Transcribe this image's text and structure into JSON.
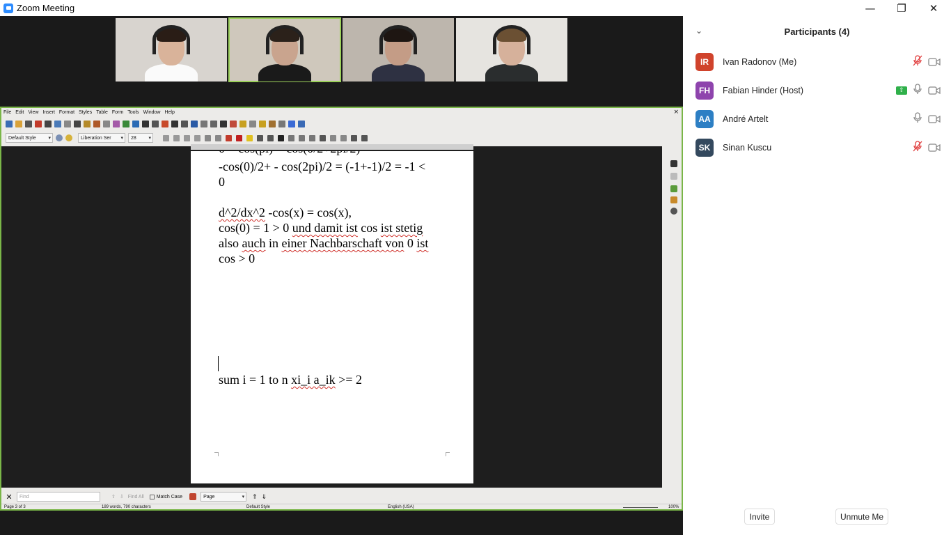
{
  "window": {
    "title": "Zoom Meeting",
    "min": "—",
    "max": "❐",
    "close": "✕"
  },
  "thumbnails": [
    {
      "bg": "#d8d4cf",
      "skin": "#d9b39a",
      "hair": "#2a1d16",
      "shirt": "#fafafa"
    },
    {
      "bg": "#cfc8bc",
      "skin": "#c9a48e",
      "hair": "#2b211a",
      "shirt": "#1a1a1a"
    },
    {
      "bg": "#bdb6ad",
      "skin": "#c49c86",
      "hair": "#1e1612",
      "shirt": "#2e3142"
    },
    {
      "bg": "#e6e4e0",
      "skin": "#d6b19b",
      "hair": "#6b5033",
      "shirt": "#2a2d2e"
    }
  ],
  "libreoffice": {
    "menu": [
      "File",
      "Edit",
      "View",
      "Insert",
      "Format",
      "Styles",
      "Table",
      "Form",
      "Tools",
      "Window",
      "Help"
    ],
    "close": "×",
    "style": "Default Style",
    "font": "Liberation Ser",
    "size": "28",
    "lines": [
      "-cos(0)/2+ - cos(2pi)/2 = (-1+-1)/2 = -1 <",
      "0",
      "d^2/dx^2 -cos(x) = cos(x),",
      "cos(0) = 1 > 0 und damit ist cos ist stetig",
      "also auch in einer Nachbarschaft von 0 ist",
      "cos > 0",
      "sum i = 1 to n xi_i a_ik >= 2"
    ],
    "find": {
      "placeholder": "Find",
      "find_all": "Find All",
      "match_case": "Match Case",
      "page": "Page"
    },
    "status": {
      "page": "Page 3 of 3",
      "words": "189 words, 790 characters",
      "style": "Default Style",
      "lang": "English (USA)",
      "zoom": "100%"
    }
  },
  "participants": {
    "title": "Participants (4)",
    "list": [
      {
        "initials": "IR",
        "name": "Ivan Radonov (Me)",
        "color": "#d0432c",
        "muted": true,
        "sharing": false
      },
      {
        "initials": "FH",
        "name": "Fabian Hinder (Host)",
        "color": "#8e44ad",
        "muted": false,
        "sharing": true
      },
      {
        "initials": "AA",
        "name": "André Artelt",
        "color": "#2d7fc4",
        "muted": false,
        "sharing": false
      },
      {
        "initials": "SK",
        "name": "Sinan Kuscu",
        "color": "#34495e",
        "muted": true,
        "sharing": false
      }
    ],
    "invite": "Invite",
    "unmute": "Unmute Me"
  }
}
